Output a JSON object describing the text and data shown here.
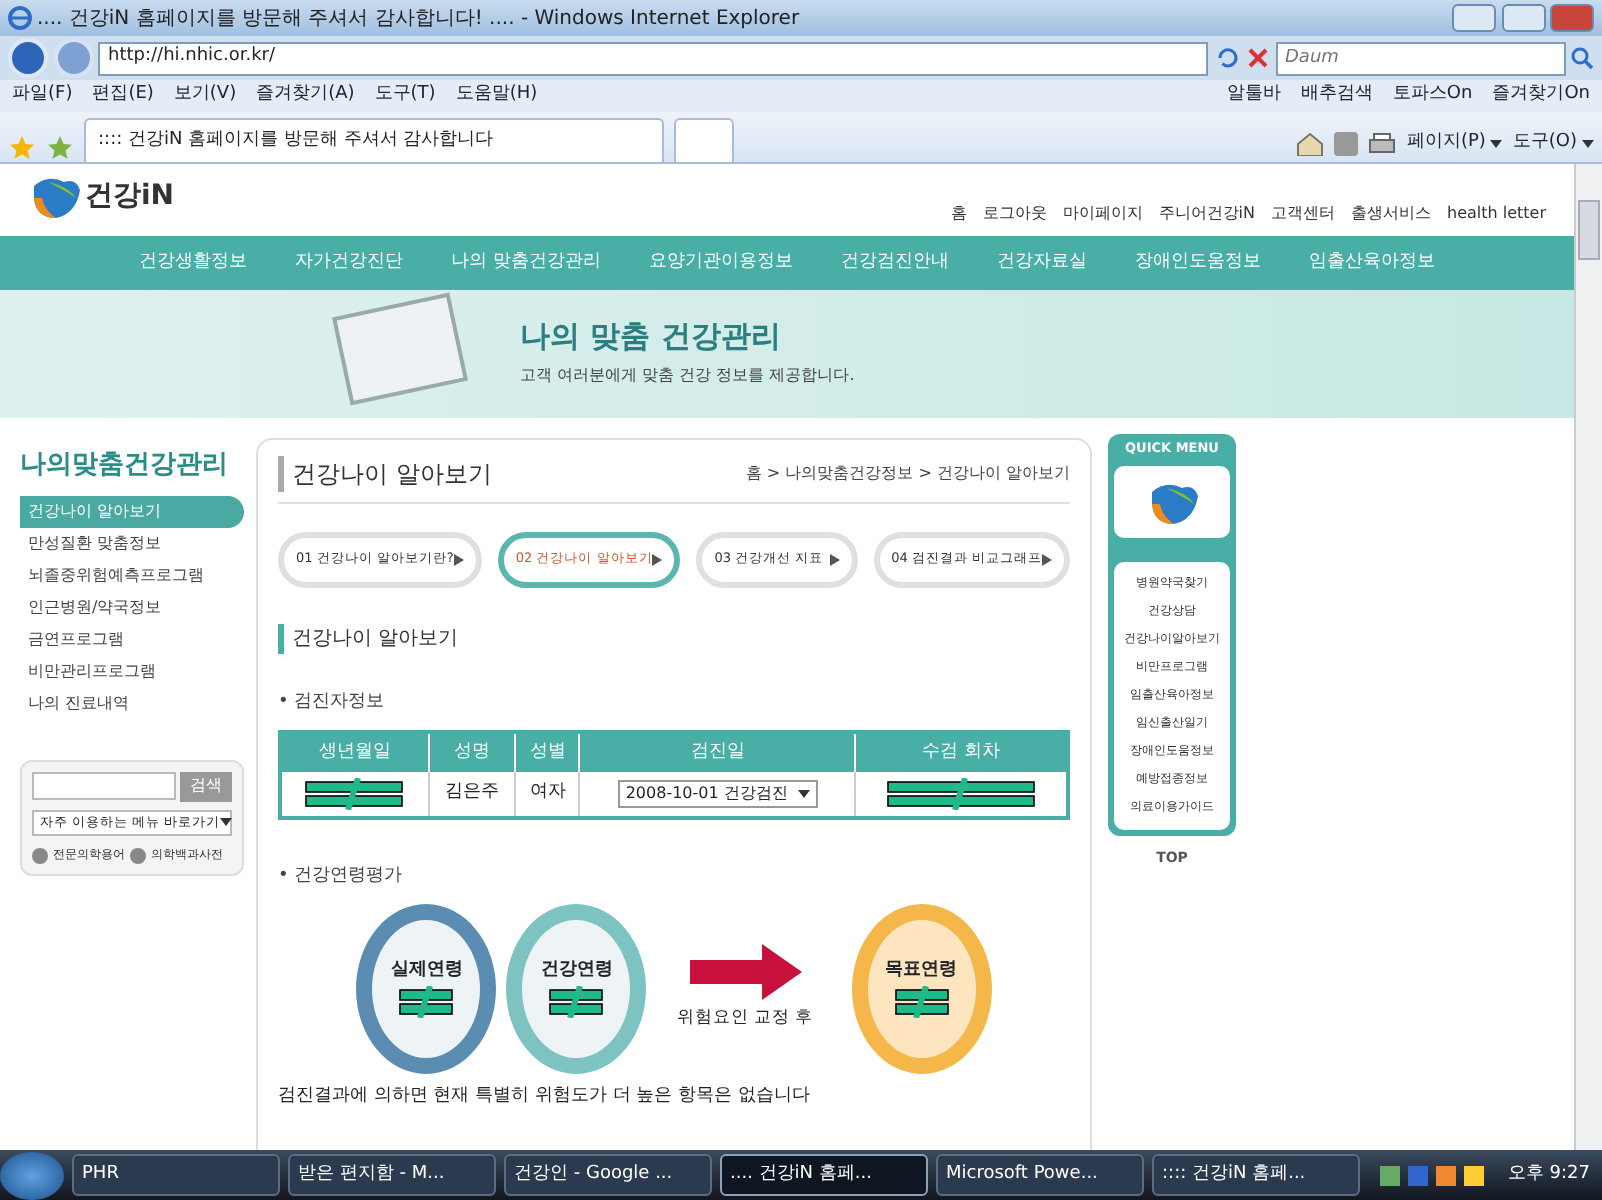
{
  "browser": {
    "title": ".... 건강iN 홈페이지를 방문해 주셔서 감사합니다! .... - Windows Internet Explorer",
    "address": "http://hi.nhic.or.kr/",
    "search": {
      "placeholder": "Daum"
    },
    "menu": [
      "파일(F)",
      "편집(E)",
      "보기(V)",
      "즐겨찾기(A)",
      "도구(T)",
      "도움말(H)"
    ],
    "toolbar_links": [
      "알툴바",
      "배추검색",
      "토파스On",
      "즐겨찾기On"
    ],
    "tab": ":::: 건강iN 홈페이지를 방문해 주셔서 감사합니다",
    "commands": [
      "페이지(P)",
      "도구(O)"
    ]
  },
  "site": {
    "logo": "건강iN",
    "top_links": [
      "홈",
      "로그아웃",
      "마이페이지",
      "주니어건강iN",
      "고객센터",
      "출생서비스",
      "health letter"
    ],
    "nav": [
      "건강생활정보",
      "자가건강진단",
      "나의 맞춤건강관리",
      "요양기관이용정보",
      "건강검진안내",
      "건강자료실",
      "장애인도움정보",
      "임출산육아정보"
    ],
    "banner": {
      "title": "나의 맞춤 건강관리",
      "subtitle": "고객 여러분에게 맞춤 건강 정보를 제공합니다."
    }
  },
  "sidebar": {
    "title": "나의맞춤건강관리",
    "items": [
      {
        "label": "건강나이 알아보기",
        "selected": true
      },
      {
        "label": "만성질환 맞춤정보",
        "selected": false
      },
      {
        "label": "뇌졸중위험예측프로그램",
        "selected": false
      },
      {
        "label": "인근병원/약국정보",
        "selected": false
      },
      {
        "label": "금연프로그램",
        "selected": false
      },
      {
        "label": "비만관리프로그램",
        "selected": false
      },
      {
        "label": "나의 진료내역",
        "selected": false
      }
    ],
    "search": {
      "button": "검색",
      "select": "자주 이용하는 메뉴 바로가기",
      "links": [
        "전문의학용어",
        "의학백과사전"
      ]
    }
  },
  "content": {
    "title": "건강나이 알아보기",
    "breadcrumb": "홈 > 나의맞춤건강정보 > 건강나이 알아보기",
    "steps": [
      {
        "label": "01 건강나이 알아보기란?",
        "selected": false
      },
      {
        "label": "02 건강나이 알아보기",
        "selected": true
      },
      {
        "label": "03 건강개선 지표",
        "selected": false
      },
      {
        "label": "04 검진결과 비교그래프",
        "selected": false
      }
    ],
    "section_title": "건강나이 알아보기",
    "patient_heading": "• 검진자정보",
    "table": {
      "columns": [
        "생년월일",
        "성명",
        "성별",
        "검진일",
        "수검 회차"
      ],
      "rows": [
        {
          "cells": [
            {
              "kind": "redacted"
            },
            {
              "kind": "text",
              "text": "김은주"
            },
            {
              "kind": "text",
              "text": "여자"
            },
            {
              "kind": "select",
              "text": "2008-10-01 건강검진"
            },
            {
              "kind": "redacted"
            }
          ]
        }
      ]
    },
    "evaluation_heading": "• 건강연령평가",
    "ages": [
      {
        "kind": "circle",
        "label": "실제연령",
        "color": "#5b8db3"
      },
      {
        "kind": "circle",
        "label": "건강연령",
        "color": "#7cc3c1"
      },
      {
        "kind": "arrow",
        "label": "위험요인 교정 후"
      },
      {
        "kind": "circle",
        "label": "목표연령",
        "color": "#f6b74a"
      }
    ],
    "note": "검진결과에 의하면 현재 특별히 위험도가 더 높은 항목은 없습니다"
  },
  "quick_menu": {
    "title": "QUICK MENU",
    "items": [
      "병원약국찾기",
      "건강상담",
      "건강나이알아보기",
      "비만프로그램",
      "임출산육아정보",
      "임신출산일기",
      "장애인도움정보",
      "예방접종정보",
      "의료이용가이드"
    ],
    "top": "TOP"
  },
  "taskbar": {
    "items": [
      {
        "label": "PHR",
        "selected": false
      },
      {
        "label": "받은 편지함 - M...",
        "selected": false
      },
      {
        "label": "건강인 - Google ...",
        "selected": false
      },
      {
        "label": ".... 건강iN 홈페...",
        "selected": true
      },
      {
        "label": "Microsoft Powe...",
        "selected": false
      },
      {
        "label": ":::: 건강iN 홈페...",
        "selected": false
      }
    ],
    "clock": "오후 9:27"
  }
}
